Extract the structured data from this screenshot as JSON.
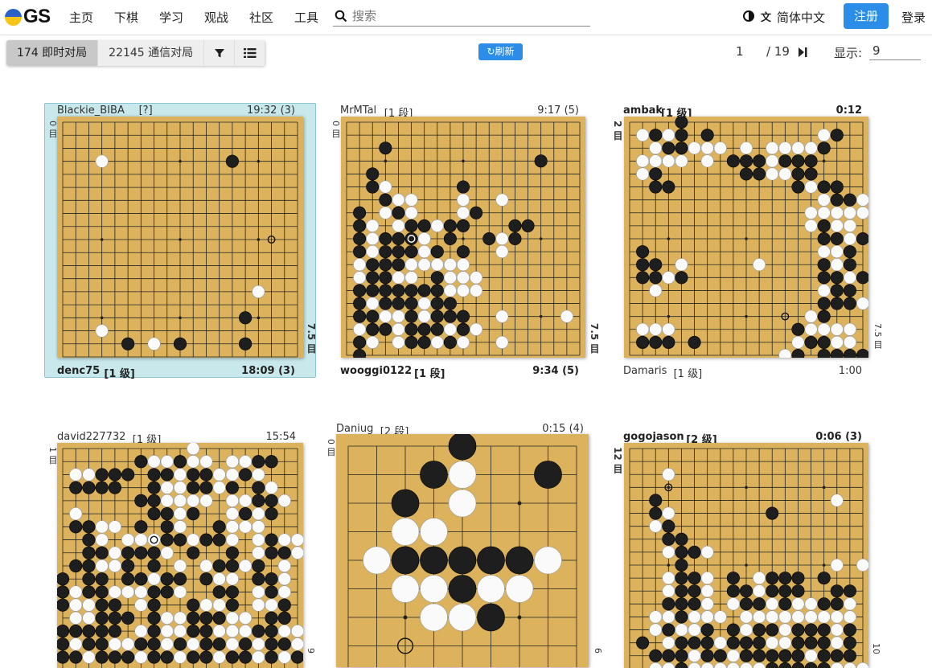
{
  "nav": {
    "logo_text": "GS",
    "links": [
      "主页",
      "下棋",
      "学习",
      "观战",
      "社区",
      "工具"
    ],
    "search_placeholder": "搜索",
    "language": "简体中文",
    "register": "注册",
    "login": "登录"
  },
  "toolbar": {
    "live_games": "174 即时对局",
    "correspondence_games": "22145 通信对局",
    "filter_icon": "filter-icon",
    "list_icon": "list-icon",
    "refresh": "刷新",
    "page_current": "1",
    "page_total": "/ 19",
    "show_label": "显示:",
    "show_value": "9"
  },
  "colors": {
    "board": "#dcb35c",
    "accent": "#2b8de8",
    "selected_card": "#c8e8ec"
  },
  "games": [
    {
      "id": "g1",
      "selected": true,
      "size": 19,
      "top": {
        "name": "Blackie_BIBA",
        "rank": "[?]",
        "time": "19:32  (3)",
        "bold": false,
        "captures": "0 目"
      },
      "bottom": {
        "name": "denc75",
        "rank": "[1 级]",
        "time": "18:09  (3)",
        "bold": true,
        "captures": "7.5 目"
      },
      "last": [
        9,
        16
      ],
      "rows": [
        "...................",
        "...................",
        "...................",
        "...O.........X.....",
        "...................",
        "...................",
        "...................",
        "...................",
        "...................",
        "...................",
        "...................",
        "...................",
        "...................",
        "...............O...",
        "...................",
        "..............X....",
        "...O...............",
        ".....X.O.X....X....",
        "...................",
        "..................."
      ]
    },
    {
      "id": "g2",
      "selected": false,
      "size": 19,
      "top": {
        "name": "MrMTal",
        "rank": "[1 段]",
        "time": "9:17  (5)",
        "bold": false,
        "captures": "0 目"
      },
      "bottom": {
        "name": "wooggi0122",
        "rank": "[1 段]",
        "time": "9:34  (5)",
        "bold": true,
        "captures": "7.5 目"
      },
      "last": [
        9,
        5
      ],
      "rows": [
        "...................",
        "...................",
        "...X...............",
        "...............X...",
        "..X................",
        "..XO.....X.........",
        "...XOO...O..O......",
        ".X.OXO...OX........",
        ".XO.OXXOXX...XX....",
        ".XOXXXO.X..XOX.....",
        ".XOXXXOX.X..O......",
        ".OXXXOOOOO.........",
        ".OXXOO.XOOO........",
        ".XXXXXXXOOO........",
        ".XOXXXOXX..........",
        ".XXOOXOXXX..O....O.",
        ".OXXOXXXOXO........",
        ".XO.OXXOXO..O......",
        ".X................."
      ]
    },
    {
      "id": "g3",
      "selected": false,
      "size": 19,
      "top": {
        "name": "ambak",
        "rank": "[1 级]",
        "time": "0:12",
        "bold": true,
        "captures": "2 目"
      },
      "bottom": {
        "name": "Damaris",
        "rank": "[1 级]",
        "time": "1:00",
        "bold": false,
        "captures": "7.5 目"
      },
      "last": [
        15,
        12
      ],
      "rows": [
        "....X..............",
        ".OXOX.X........OX..",
        "..OXXOOO.O.OOOOX...",
        ".OOOO.O.XXXOXXX....",
        ".OX......XXOOXX....",
        "..XX.........XOXX..",
        "...............OXXO",
        "..............OOOOOO",
        "..............OXOO.",
        "...............XXOX..",
        ".X.............OOX.",
        ".XX.O.....O....XOX.",
        ".XXOX..........XXOX",
        "..O............OXX.",
        "...............XXXO",
        "..............OX...",
        ".OOO.........XOOOO.",
        ".XXX.X.......OXXOO.",
        "............OX.XXXX",
        "..............X...."
      ]
    },
    {
      "id": "g4",
      "selected": false,
      "size": 19,
      "top": {
        "name": "david227732",
        "rank": "[1 级]",
        "time": "15:54",
        "bold": false,
        "captures": "1 目"
      },
      "bottom": {
        "name": "",
        "rank": "",
        "time": "",
        "bold": false,
        "captures": "9"
      },
      "last": [
        7,
        7
      ],
      "rows": [
        "..........O........",
        "......XOOXOO.OOXX..",
        ".OOXXX.XXOXXOOXO...",
        ".XXXX..XOOXXOX.XO..",
        "......XXOOOO.OOXXO.",
        ".O.....XXOX..OXOX..",
        ".XXOO.X.XO..XOOO...",
        "..XO.OOOXXOXXO.OXOO",
        "..XXOXXXO.X..X.OXXO",
        ".XXOOX.X.O.OXXOX.O.",
        "X.XX.XXOXX.XOO.XXO.",
        "XOXXOOOXXO..XX.OXO.",
        "XOOXX.OX..XOOX.OOX.",
        ".OOXXX.XOOXXXOO.XX.",
        "XXXXX.OXOOXXOOOXXOO",
        "XOXXOOXXOXOXXOXOXXO",
        "XXOXXXOXXOXXOXXOXOX",
        "...................",
        "..................."
      ]
    },
    {
      "id": "g5",
      "selected": false,
      "size": 9,
      "top": {
        "name": "Daniug",
        "rank": "[2 段]",
        "time": "0:15  (4)",
        "bold": false,
        "captures": "0 目"
      },
      "bottom": {
        "name": "",
        "rank": "",
        "time": "",
        "bold": false,
        "captures": "6"
      },
      "last": [
        7,
        2
      ],
      "rows": [
        "....X....",
        "...XO..X.",
        "..X.O....",
        "..OO.....",
        ".OXXXXXO.",
        "..OOXOO..",
        "...OOX...",
        "........."
      ]
    },
    {
      "id": "g6",
      "selected": false,
      "size": 19,
      "top": {
        "name": "gogojason",
        "rank": "[2 级]",
        "time": "0:06  (3)",
        "bold": true,
        "captures": "12 目"
      },
      "bottom": {
        "name": "",
        "rank": "",
        "time": "",
        "bold": false,
        "captures": "10"
      },
      "last": [
        3,
        3
      ],
      "rows": [
        "...................",
        "...................",
        "...O...............",
        "...................",
        "..X.............O..",
        "..XO.......X.......",
        "..OX...............",
        "...XX..............",
        "...OXXO............",
        "....X...........O.O",
        "...OXXO.X.OXXX.X...",
        "...OXXO.XXOXXX..XX.",
        "...XXXO.OXXOXOOXXO.",
        "..OOXOOO.OOOOOOOOO.",
        "..OXOOX.XOXXOXXXOX.",
        ".X.OXXXOXXXOOXXXOX.",
        "..XXXOXXOXXXXXOXXX.",
        "..OOXOOOOOOXXXXXOOO.",
        "..XXOXXOXXXXOXXXXXO"
      ]
    }
  ]
}
